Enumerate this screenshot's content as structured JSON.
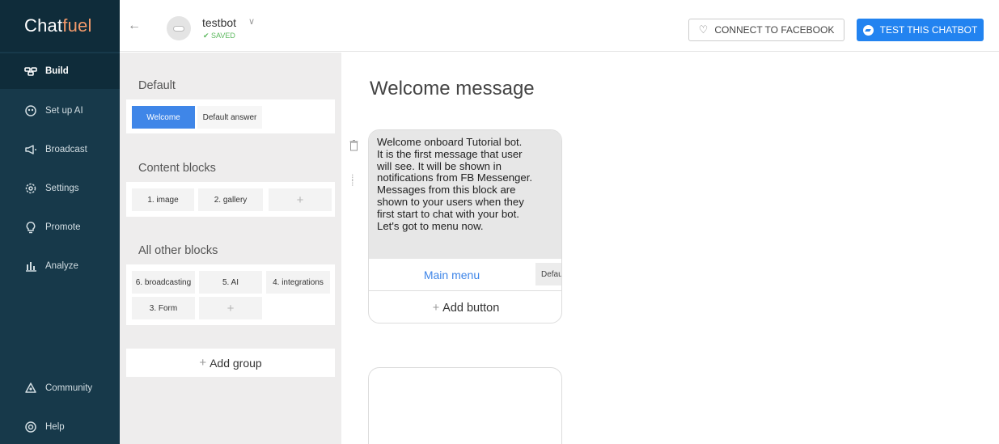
{
  "app": {
    "logo_part1": "Chat",
    "logo_part2": "fuel",
    "accent_color": "#f39a6b",
    "sidebar_color": "#17394a"
  },
  "sidebar": {
    "items": [
      {
        "label": "Build",
        "icon": "build-icon",
        "active": true
      },
      {
        "label": "Set up AI",
        "icon": "ai-icon"
      },
      {
        "label": "Broadcast",
        "icon": "megaphone-icon"
      },
      {
        "label": "Settings",
        "icon": "gear-icon"
      },
      {
        "label": "Promote",
        "icon": "lightbulb-icon"
      },
      {
        "label": "Analyze",
        "icon": "chart-icon"
      },
      {
        "label": "Community",
        "icon": "community-icon"
      },
      {
        "label": "Help",
        "icon": "lifebuoy-icon"
      }
    ]
  },
  "header": {
    "bot_name": "testbot",
    "saved_status": "✔ SAVED",
    "connect_label": "CONNECT TO FACEBOOK",
    "test_label": "TEST THIS CHATBOT",
    "primary_color": "#2283f0"
  },
  "panel": {
    "groups": [
      {
        "title": "Default",
        "blocks": [
          "Welcome",
          "Default answer"
        ]
      },
      {
        "title": "Content blocks",
        "blocks": [
          "1. image",
          "2. gallery",
          "+"
        ]
      },
      {
        "title": "All other blocks",
        "blocks": [
          "6. broadcasting",
          "5. AI",
          "4. integrations",
          "3. Form",
          "+"
        ]
      }
    ],
    "add_group_plus": "+",
    "add_group_label": "Add group"
  },
  "editor": {
    "title": "Welcome message",
    "message_lines": [
      "Welcome onboard Tutorial bot.",
      "It is the first message that user",
      "will see. It will be shown in",
      "notifications from FB Messenger.",
      "Messages from this block are",
      "shown to your users when they",
      "first start to chat with your bot.",
      "Let's got to menu now."
    ],
    "button_label": "Main menu",
    "button_tag": "Default answer",
    "add_button_plus": "+",
    "add_button_label": "Add button"
  }
}
